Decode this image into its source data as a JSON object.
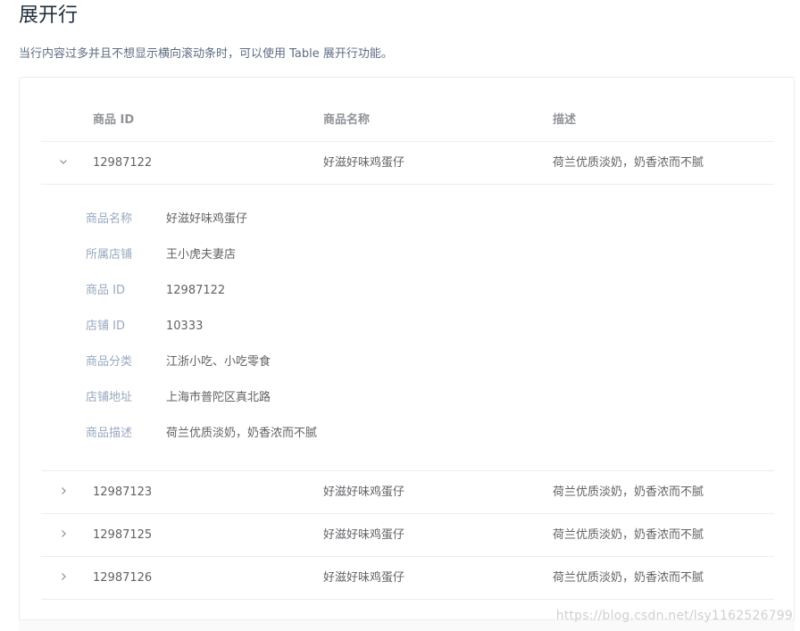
{
  "page": {
    "title": "展开行",
    "description": "当行内容过多并且不想显示横向滚动条时，可以使用 Table 展开行功能。"
  },
  "table": {
    "headers": {
      "id": "商品 ID",
      "name": "商品名称",
      "desc": "描述"
    },
    "rows": [
      {
        "id": "12987122",
        "name": "好滋好味鸡蛋仔",
        "desc": "荷兰优质淡奶，奶香浓而不腻",
        "expanded": true
      },
      {
        "id": "12987123",
        "name": "好滋好味鸡蛋仔",
        "desc": "荷兰优质淡奶，奶香浓而不腻",
        "expanded": false
      },
      {
        "id": "12987125",
        "name": "好滋好味鸡蛋仔",
        "desc": "荷兰优质淡奶，奶香浓而不腻",
        "expanded": false
      },
      {
        "id": "12987126",
        "name": "好滋好味鸡蛋仔",
        "desc": "荷兰优质淡奶，奶香浓而不腻",
        "expanded": false
      }
    ],
    "expanded_detail": [
      {
        "label": "商品名称",
        "value": "好滋好味鸡蛋仔"
      },
      {
        "label": "所属店铺",
        "value": "王小虎夫妻店"
      },
      {
        "label": "商品 ID",
        "value": "12987122"
      },
      {
        "label": "店铺 ID",
        "value": "10333"
      },
      {
        "label": "商品分类",
        "value": "江浙小吃、小吃零食"
      },
      {
        "label": "店铺地址",
        "value": "上海市普陀区真北路"
      },
      {
        "label": "商品描述",
        "value": "荷兰优质淡奶，奶香浓而不腻"
      }
    ]
  },
  "icons": {
    "expanded": "chevron-down-icon",
    "collapsed": "chevron-right-icon"
  },
  "colors": {
    "label": "#99a9bf",
    "header": "#909399",
    "text": "#606266",
    "border": "#ebeef5"
  },
  "watermark": "https://blog.csdn.net/lsy1162526799"
}
